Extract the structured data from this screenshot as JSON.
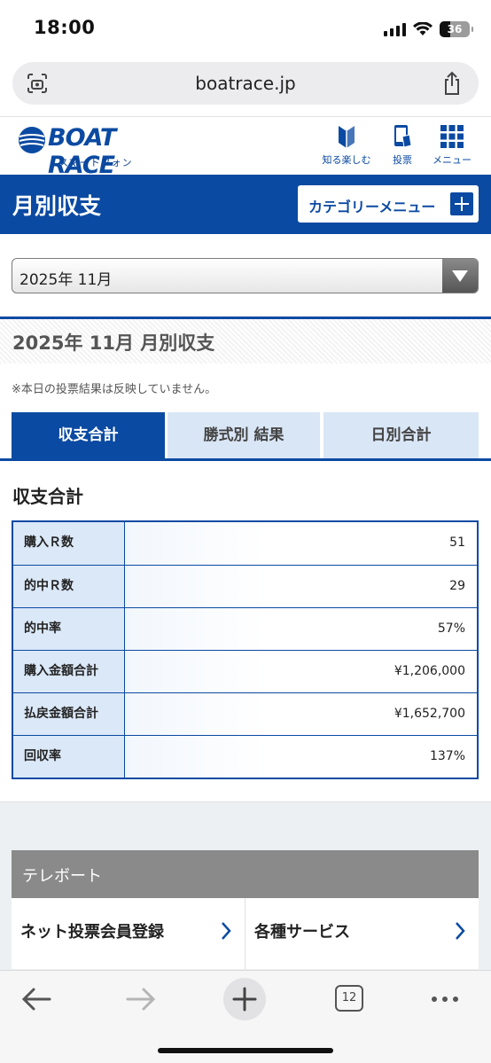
{
  "status": {
    "time": "18:00",
    "battery": "36"
  },
  "browser": {
    "url": "boatrace.jp",
    "open_tabs": "12"
  },
  "site": {
    "logo_text": "BOAT RACE",
    "logo_sub": "スマートフォン",
    "nav": {
      "know": "知る楽しむ",
      "vote": "投票",
      "menu": "メニュー"
    }
  },
  "page": {
    "title": "月別収支",
    "category_button": "カテゴリーメニュー",
    "month_select_value": "2025年 11月",
    "section_heading": "2025年 11月 月別収支",
    "note": "※本日の投票結果は反映していません。",
    "tabs": [
      {
        "label": "収支合計",
        "active": true
      },
      {
        "label": "勝式別 結果",
        "active": false
      },
      {
        "label": "日別合計",
        "active": false
      }
    ],
    "summary_heading": "収支合計",
    "summary_rows": [
      {
        "label": "購入Ｒ数",
        "value": "51"
      },
      {
        "label": "的中Ｒ数",
        "value": "29"
      },
      {
        "label": "的中率",
        "value": "57%"
      },
      {
        "label": "購入金額合計",
        "value": "¥1,206,000"
      },
      {
        "label": "払戻金額合計",
        "value": "¥1,652,700"
      },
      {
        "label": "回収率",
        "value": "137%"
      }
    ]
  },
  "footer": {
    "teleboat_label": "テレボート",
    "links": [
      "ネット投票会員登録",
      "各種サービス"
    ]
  },
  "colors": {
    "brand_blue": "#0b4aa2",
    "tab_inactive": "#d9e6f6",
    "label_bg": "#dbe8f8"
  }
}
